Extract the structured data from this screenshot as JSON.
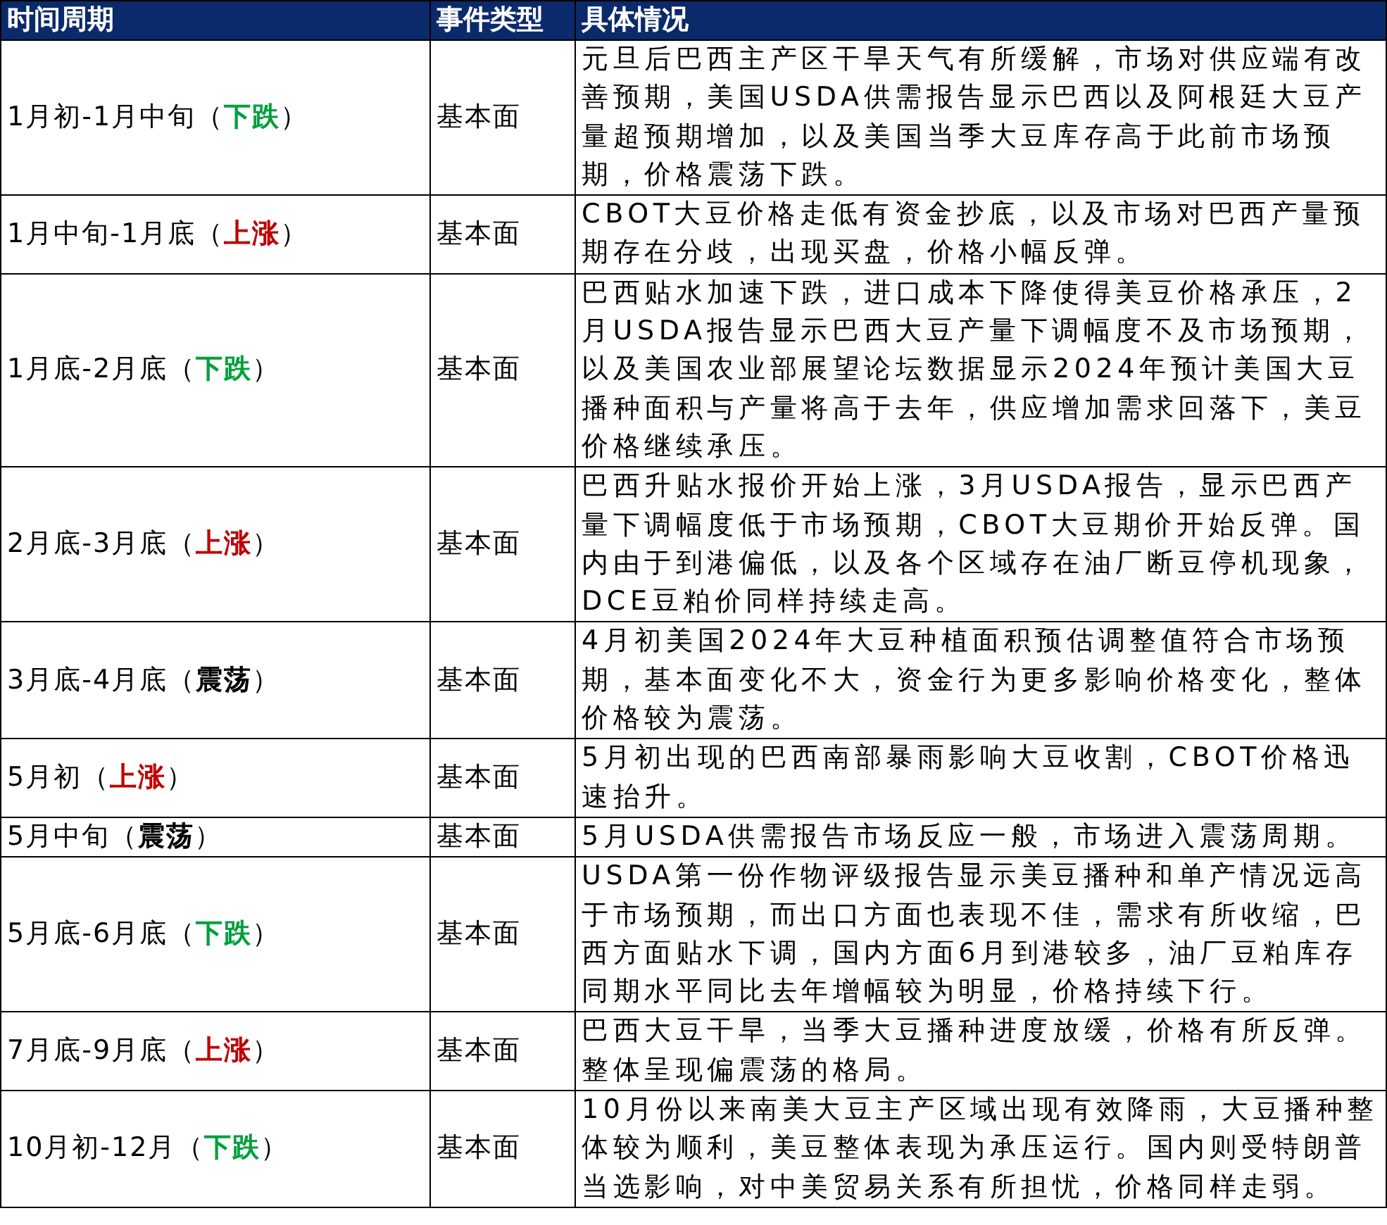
{
  "table": {
    "columns": [
      "时间周期",
      "事件类型",
      "具体情况"
    ],
    "rows": [
      {
        "period": "1月初-1月中旬",
        "trend": "（下跌）",
        "color": "#00a03c",
        "type": "基本面",
        "detail": "元旦后巴西主产区干旱天气有所缓解，市场对供应端有改善预期，美国USDA供需报告显示巴西以及阿根廷大豆产量超预期增加，以及美国当季大豆库存高于此前市场预期，价格震荡下跌。"
      },
      {
        "period": "1月中旬-1月底",
        "trend": "（上涨）",
        "color": "#c00000",
        "type": "基本面",
        "detail": "CBOT大豆价格走低有资金抄底，以及市场对巴西产量预期存在分歧，出现买盘，价格小幅反弹。"
      },
      {
        "period": "1月底-2月底",
        "trend": "（下跌）",
        "color": "#00a03c",
        "type": "基本面",
        "detail": "巴西贴水加速下跌，进口成本下降使得美豆价格承压，2月USDA报告显示巴西大豆产量下调幅度不及市场预期，以及美国农业部展望论坛数据显示2024年预计美国大豆播种面积与产量将高于去年，供应增加需求回落下，美豆价格继续承压。"
      },
      {
        "period": "2月底-3月底",
        "trend": "（上涨）",
        "color": "#c00000",
        "type": "基本面",
        "detail": "巴西升贴水报价开始上涨，3月USDA报告，显示巴西产量下调幅度低于市场预期，CBOT大豆期价开始反弹。国内由于到港偏低，以及各个区域存在油厂断豆停机现象，DCE豆粕价同样持续走高。"
      },
      {
        "period": "3月底-4月底",
        "trend": "（震荡）",
        "color": "#000000",
        "type": "基本面",
        "detail": "4月初美国2024年大豆种植面积预估调整值符合市场预期，基本面变化不大，资金行为更多影响价格变化，整体价格较为震荡。"
      },
      {
        "period": "5月初",
        "trend": "（上涨）",
        "color": "#c00000",
        "type": "基本面",
        "detail": "5月初出现的巴西南部暴雨影响大豆收割，CBOT价格迅速抬升。"
      },
      {
        "period": "5月中旬",
        "trend": "（震荡）",
        "color": "#000000",
        "type": "基本面",
        "detail": "5月USDA供需报告市场反应一般，市场进入震荡周期。"
      },
      {
        "period": "5月底-6月底",
        "trend": "（下跌）",
        "color": "#00a03c",
        "type": "基本面",
        "detail": "USDA第一份作物评级报告显示美豆播种和单产情况远高于市场预期，而出口方面也表现不佳，需求有所收缩，巴西方面贴水下调，国内方面6月到港较多，油厂豆粕库存同期水平同比去年增幅较为明显，价格持续下行。"
      },
      {
        "period": "7月底-9月底",
        "trend": "（上涨）",
        "color": "#c00000",
        "type": "基本面",
        "detail": "巴西大豆干旱，当季大豆播种进度放缓，价格有所反弹。整体呈现偏震荡的格局。"
      },
      {
        "period": "10月初-12月",
        "trend": "（下跌）",
        "color": "#00a03c",
        "type": "基本面",
        "detail": "10月份以来南美大豆主产区域出现有效降雨，大豆播种整体较为顺利，美豆整体表现为承压运行。国内则受特朗普当选影响，对中美贸易关系有所担忧，价格同样走弱。"
      }
    ]
  }
}
